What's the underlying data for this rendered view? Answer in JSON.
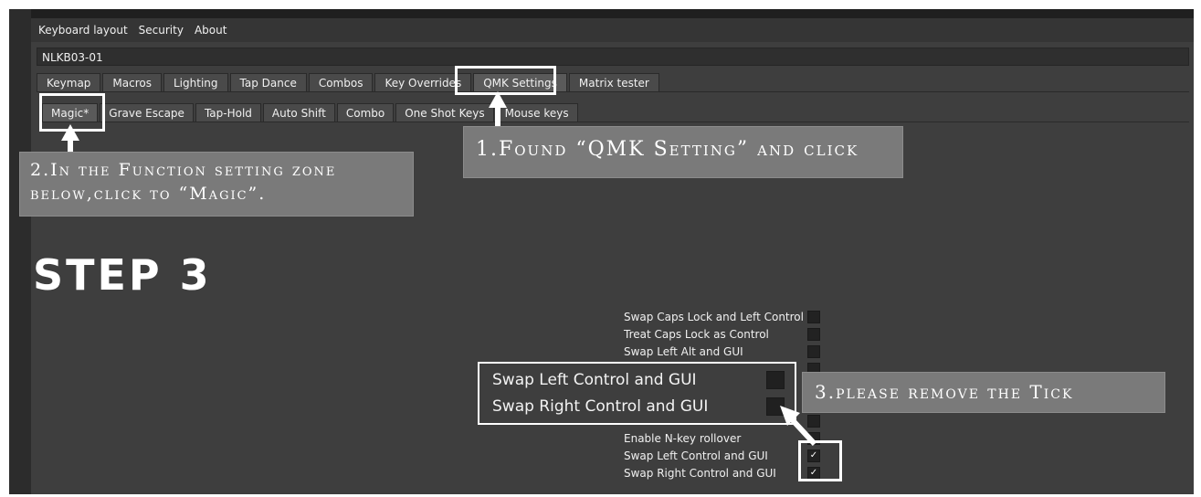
{
  "menubar": {
    "items": [
      "Keyboard layout",
      "Security",
      "About"
    ]
  },
  "device": {
    "name": "NLKB03-01"
  },
  "tabs": {
    "items": [
      "Keymap",
      "Macros",
      "Lighting",
      "Tap Dance",
      "Combos",
      "Key Overrides",
      "QMK Settings",
      "Matrix tester"
    ],
    "active": "QMK Settings"
  },
  "subtabs": {
    "items": [
      "Magic*",
      "Grave Escape",
      "Tap-Hold",
      "Auto Shift",
      "Combo",
      "One Shot Keys",
      "Mouse keys"
    ],
    "active": "Magic*"
  },
  "callouts": {
    "step1": "1.Found “QMK Setting” and click",
    "step2_line1": "2.In the Function setting zone",
    "step2_line2": "below,click to “Magic”.",
    "step3": "3.please remove the Tick"
  },
  "step_heading": "STEP 3",
  "options": [
    {
      "label": "Swap Caps Lock and Left Control",
      "checked": false
    },
    {
      "label": "Treat Caps Lock as Control",
      "checked": false
    },
    {
      "label": "Swap Left Alt and GUI",
      "checked": false
    },
    {
      "label": "Enable N-key rollover",
      "checked": false
    },
    {
      "label": "Swap Left Control and GUI",
      "checked": true
    },
    {
      "label": "Swap Right Control and GUI",
      "checked": true
    }
  ],
  "zoom": {
    "rows": [
      {
        "label": "Swap Left Control and GUI",
        "checked": false
      },
      {
        "label": "Swap Right Control and GUI",
        "checked": false
      }
    ]
  },
  "check_glyph": "✓",
  "colors": {
    "app_bg": "#3e3e3e",
    "callout_bg": "#7a7a7a",
    "highlight": "#ffffff"
  }
}
